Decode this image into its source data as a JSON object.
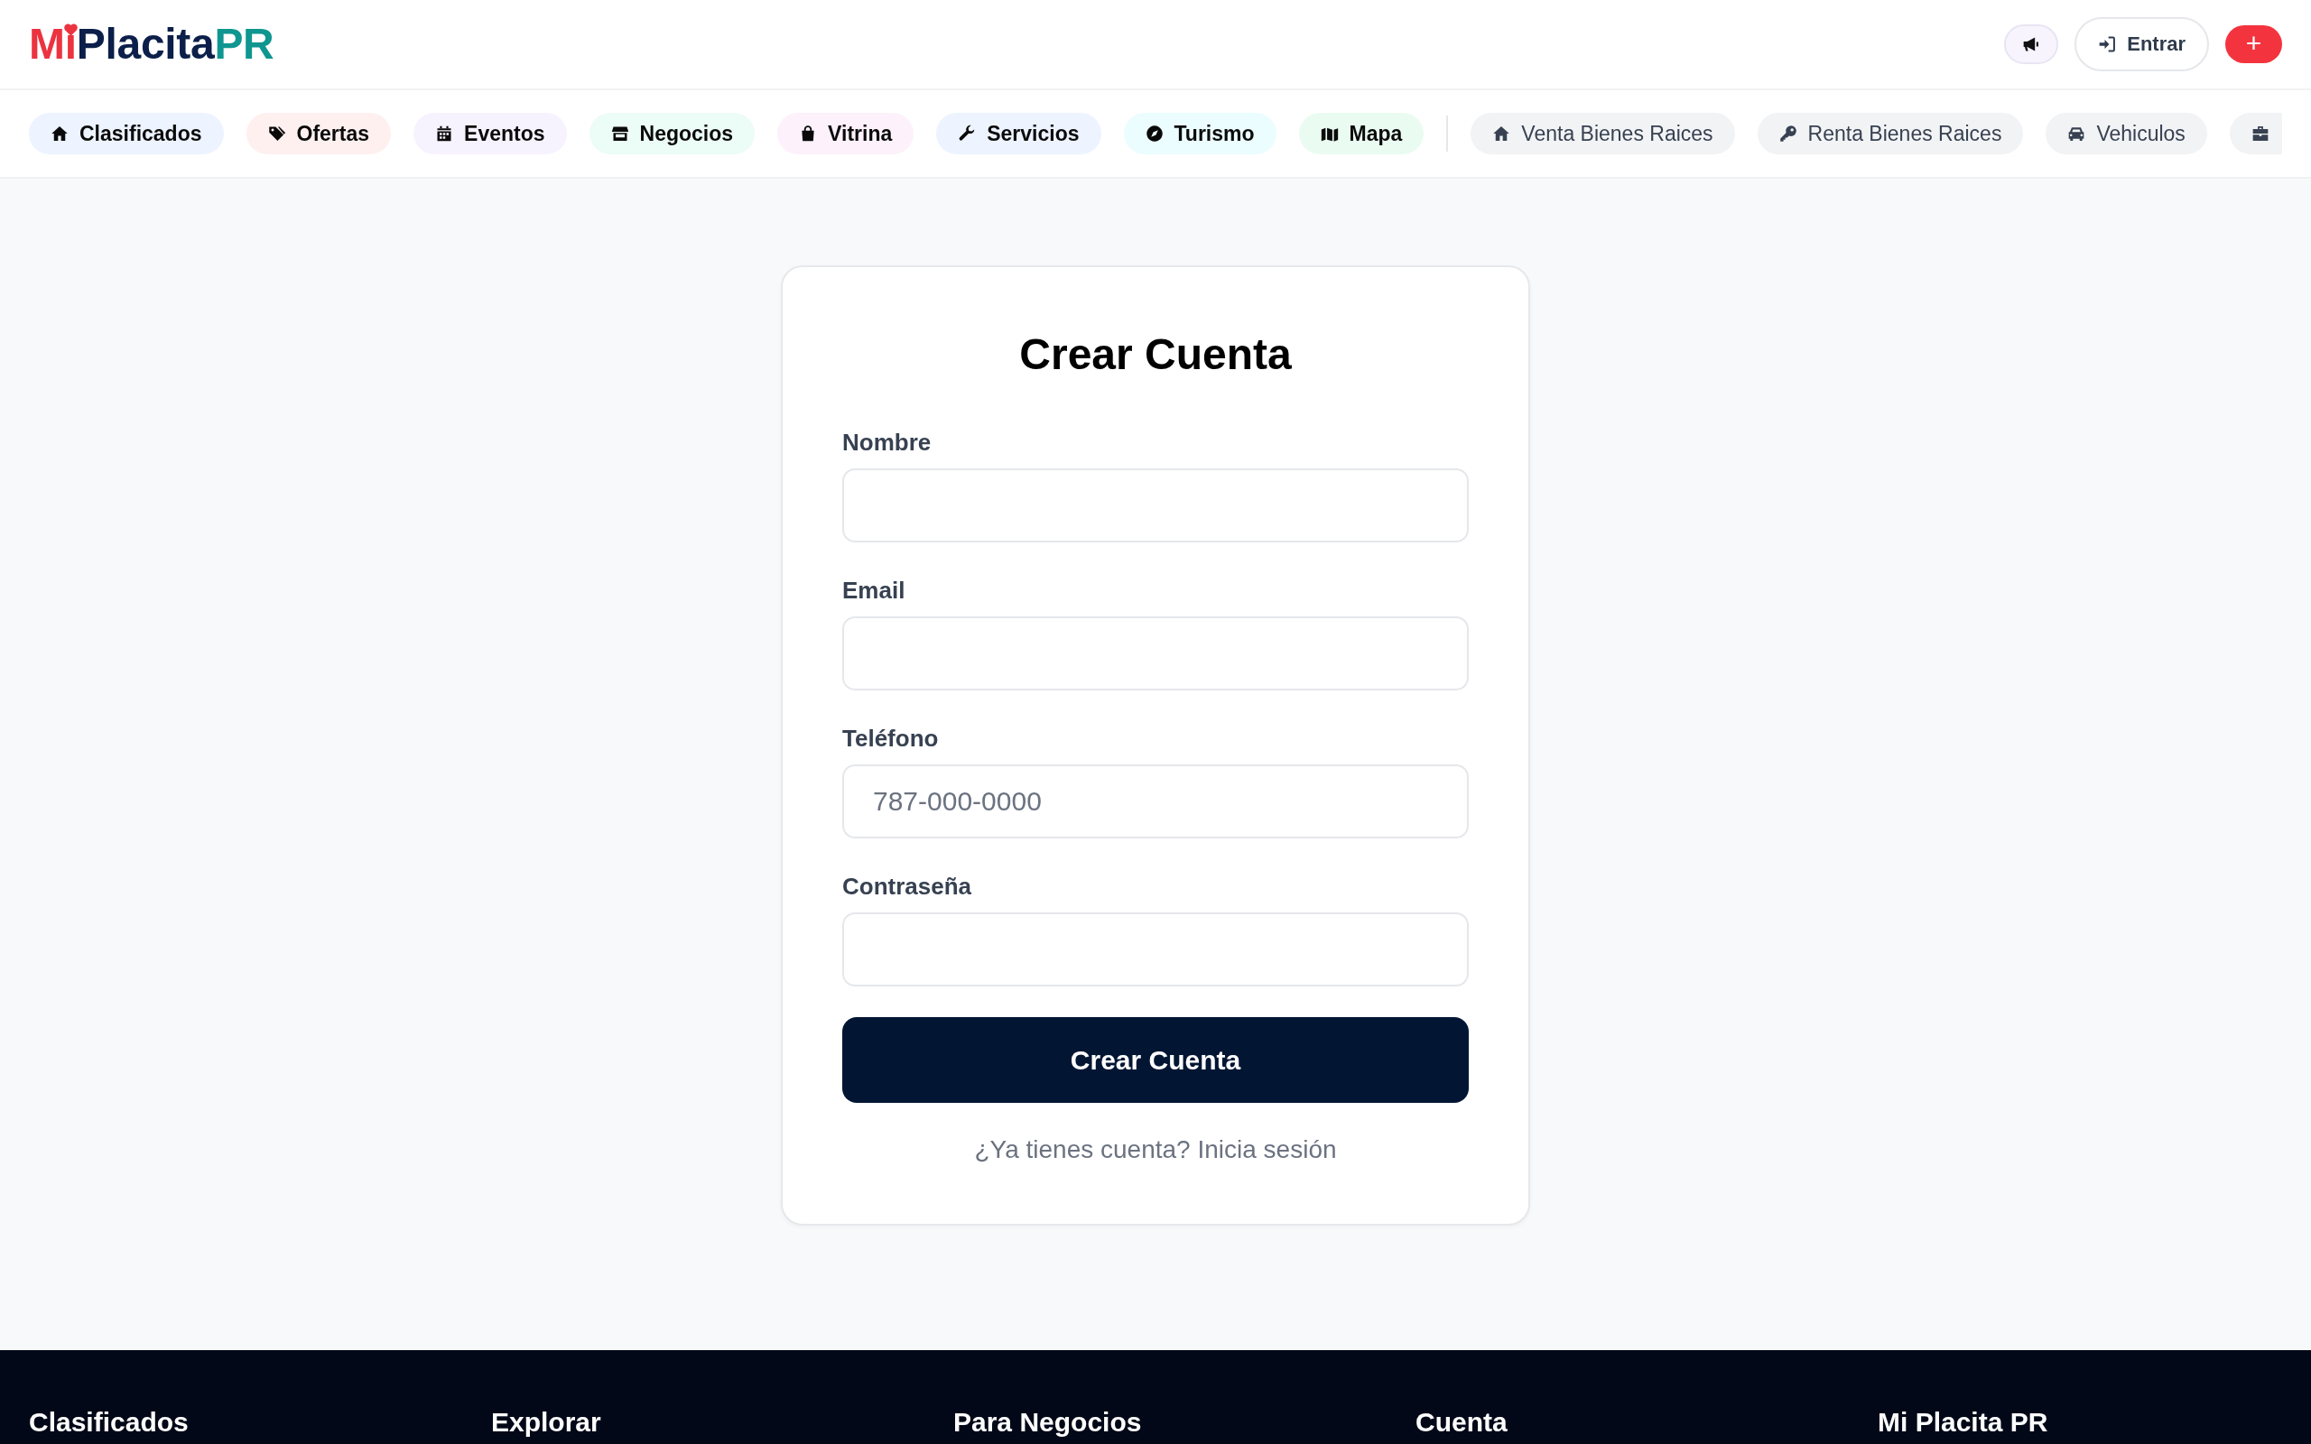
{
  "header": {
    "logo": {
      "parts": [
        "Mi",
        "Placita",
        "PR"
      ]
    },
    "actions": [
      {
        "kind": "announce"
      },
      {
        "kind": "login",
        "label": "Entrar"
      },
      {
        "kind": "create",
        "label": "+"
      }
    ]
  },
  "nav": {
    "primary": [
      {
        "label": "Clasificados",
        "color": "#edf3ff"
      },
      {
        "label": "Ofertas",
        "color": "#fff0f0"
      },
      {
        "label": "Eventos",
        "color": "#f7f3fe"
      },
      {
        "label": "Negocios",
        "color": "#ecfcf7"
      },
      {
        "label": "Vitrina",
        "color": "#fdf1fb"
      },
      {
        "label": "Servicios",
        "color": "#edf3ff"
      },
      {
        "label": "Turismo",
        "color": "#ebfdfe"
      },
      {
        "label": "Mapa",
        "color": "#eafcf2"
      }
    ],
    "secondary": [
      {
        "label": "Venta Bienes Raices",
        "cut_off": false
      },
      {
        "label": "Renta Bienes Raices",
        "cut_off": false
      },
      {
        "label": "Vehiculos",
        "cut_off": false
      },
      {
        "cut_off": true
      }
    ]
  },
  "form": {
    "title": "Crear Cuenta",
    "fields": [
      {
        "label": "Nombre"
      },
      {
        "label": "Email"
      },
      {
        "label": "Teléfono",
        "placeholder": "787-000-0000"
      },
      {
        "label": "Contraseña"
      }
    ],
    "submit": "Crear Cuenta",
    "login_prompt": "¿Ya tienes cuenta? Inicia sesión"
  },
  "footer": {
    "columns": [
      "Clasificados",
      "Explorar",
      "Para Negocios",
      "Cuenta",
      "Mi Placita PR"
    ]
  }
}
